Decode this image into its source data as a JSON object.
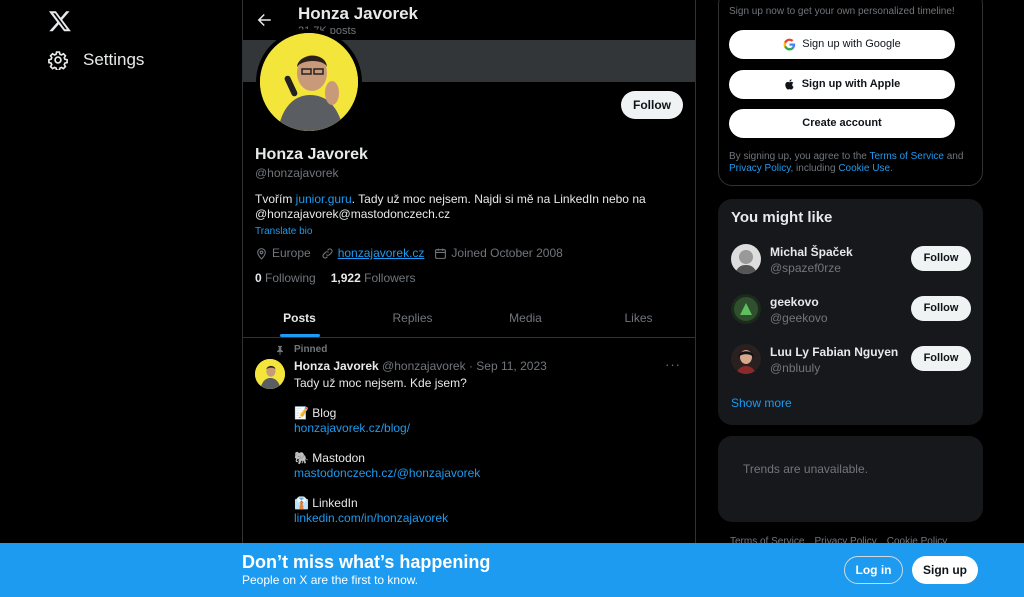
{
  "nav": {
    "logo_icon": "x-logo-icon",
    "settings_label": "Settings"
  },
  "profile": {
    "header_name": "Honza Javorek",
    "posts_count": "21.7K posts",
    "name": "Honza Javorek",
    "handle": "@honzajavorek",
    "follow_label": "Follow",
    "bio_before": "Tvořím ",
    "bio_link": "junior.guru",
    "bio_after": ". Tady už moc nejsem. Najdi si mě na LinkedIn nebo na @honzajavorek@mastodonczech.cz",
    "translate_label": "Translate bio",
    "location": "Europe",
    "website": "honzajavorek.cz",
    "joined": "Joined October 2008",
    "following_count": "0",
    "following_label": "Following",
    "followers_count": "1,922",
    "followers_label": "Followers"
  },
  "tabs": [
    {
      "label": "Posts",
      "active": true
    },
    {
      "label": "Replies",
      "active": false
    },
    {
      "label": "Media",
      "active": false
    },
    {
      "label": "Likes",
      "active": false
    }
  ],
  "tweet": {
    "pinned_label": "Pinned",
    "author_name": "Honza Javorek",
    "author_handle": "@honzajavorek",
    "date": "· Sep 11, 2023",
    "more": "···",
    "line1": "Tady už moc nejsem. Kde jsem?",
    "blog_label": "📝 Blog",
    "blog_link": "honzajavorek.cz/blog/",
    "mastodon_label": "🐘 Mastodon",
    "mastodon_link": "mastodonczech.cz/@honzajavorek",
    "linkedin_label": "👔 LinkedIn",
    "linkedin_link": "linkedin.com/in/honzajavorek"
  },
  "signup": {
    "hint": "Sign up now to get your own personalized timeline!",
    "google_label": "Sign up with Google",
    "apple_label": "Sign up with Apple",
    "create_label": "Create account",
    "legal_before": "By signing up, you agree to the ",
    "legal_tos": "Terms of Service",
    "legal_and": " and ",
    "legal_privacy": "Privacy Policy",
    "legal_including": ", including ",
    "legal_cookie": "Cookie Use",
    "legal_end": "."
  },
  "might_like": {
    "title": "You might like",
    "people": [
      {
        "name": "Michal Špaček",
        "handle": "@spazef0rze",
        "follow": "Follow"
      },
      {
        "name": "geekovo",
        "handle": "@geekovo",
        "follow": "Follow"
      },
      {
        "name": "Luu Ly Fabian Nguyen",
        "handle": "@nbluuly",
        "follow": "Follow"
      }
    ],
    "show_more": "Show more"
  },
  "trends": {
    "text": "Trends are unavailable."
  },
  "footer": {
    "links": [
      "Terms of Service",
      "Privacy Policy",
      "Cookie Policy"
    ]
  },
  "bottom_bar": {
    "title": "Don’t miss what’s happening",
    "subtitle": "People on X are the first to know.",
    "login_label": "Log in",
    "signup_label": "Sign up"
  },
  "colors": {
    "accent": "#1d9bf0",
    "background": "#000000",
    "avatar_bg": "#f4e53a"
  }
}
